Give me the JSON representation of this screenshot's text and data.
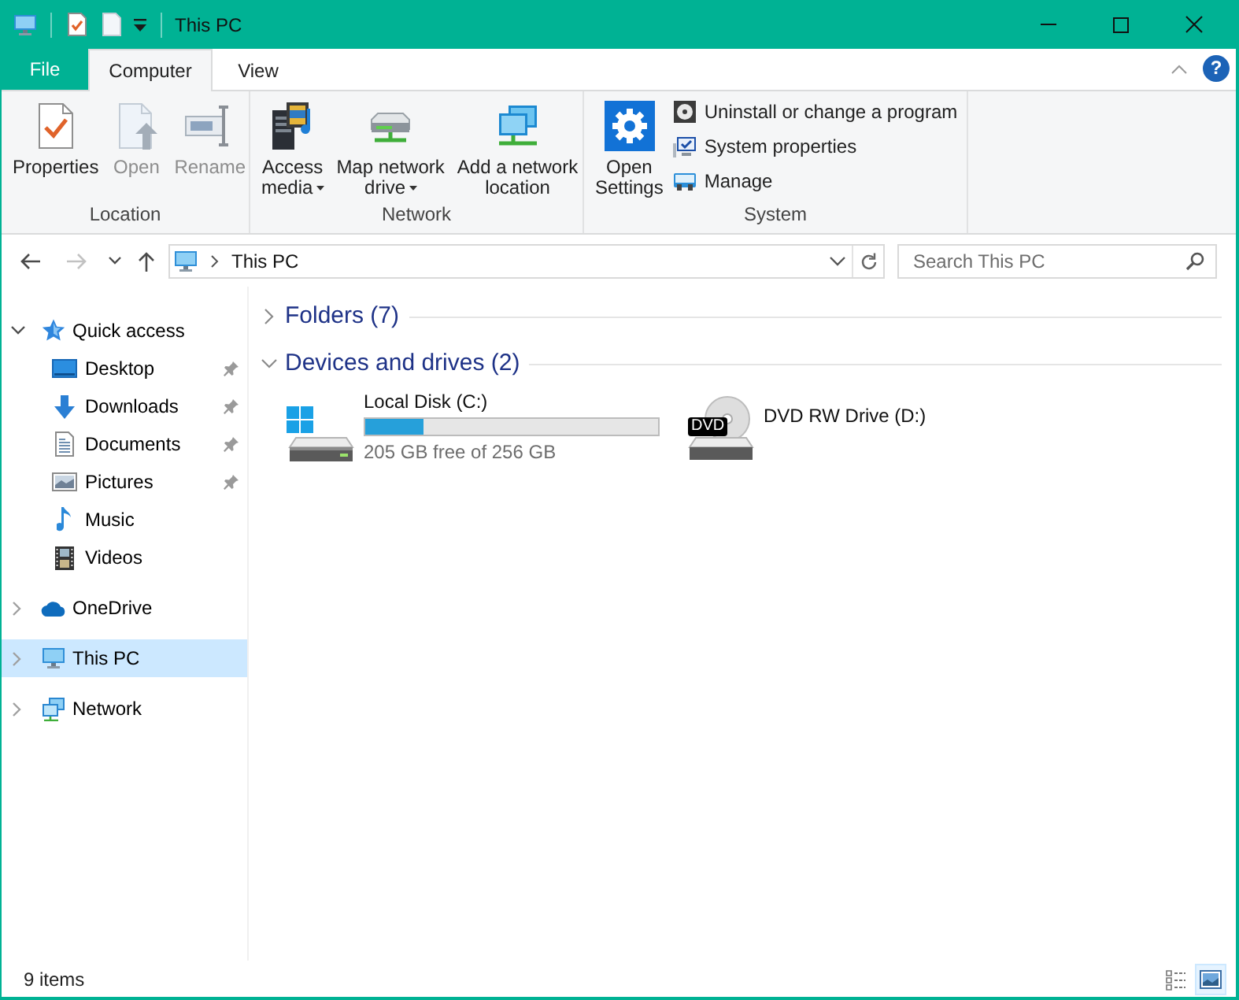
{
  "window": {
    "title": "This PC"
  },
  "ribbon": {
    "tabs": [
      {
        "label": "File",
        "kind": "file",
        "selected": false
      },
      {
        "label": "Computer",
        "kind": "tab",
        "selected": true
      },
      {
        "label": "View",
        "kind": "tab",
        "selected": false
      }
    ],
    "help": "?",
    "groups": [
      {
        "label": "Location",
        "buttons": [
          {
            "kind": "large",
            "lines": [
              "Properties"
            ],
            "dropdown": false,
            "disabled": false
          },
          {
            "kind": "large",
            "lines": [
              "Open"
            ],
            "dropdown": false,
            "disabled": true
          },
          {
            "kind": "large",
            "lines": [
              "Rename"
            ],
            "dropdown": false,
            "disabled": true
          }
        ]
      },
      {
        "label": "Network",
        "buttons": [
          {
            "kind": "large",
            "lines": [
              "Access",
              "media"
            ],
            "dropdown": true,
            "disabled": false
          },
          {
            "kind": "large",
            "lines": [
              "Map network",
              "drive"
            ],
            "dropdown": true,
            "disabled": false
          },
          {
            "kind": "large",
            "lines": [
              "Add a network",
              "location"
            ],
            "dropdown": false,
            "disabled": false
          }
        ]
      },
      {
        "label": "System",
        "buttons": [
          {
            "kind": "large",
            "lines": [
              "Open",
              "Settings"
            ],
            "dropdown": false,
            "disabled": false
          },
          {
            "kind": "small",
            "lines": [
              "Uninstall or change a program"
            ],
            "dropdown": false,
            "disabled": false
          },
          {
            "kind": "small",
            "lines": [
              "System properties"
            ],
            "dropdown": false,
            "disabled": false
          },
          {
            "kind": "small",
            "lines": [
              "Manage"
            ],
            "dropdown": false,
            "disabled": false
          }
        ]
      }
    ]
  },
  "navigation": [
    {
      "kind": "back",
      "disabled": false
    },
    {
      "kind": "forward",
      "disabled": true
    },
    {
      "kind": "recent",
      "disabled": false
    },
    {
      "kind": "up",
      "disabled": false
    }
  ],
  "address_bar": {
    "path": [
      "This PC"
    ]
  },
  "search": {
    "placeholder": "Search This PC"
  },
  "sidebar": {
    "items": [
      {
        "label": "Quick access",
        "expanded": true,
        "selected": false,
        "children": [
          {
            "label": "Desktop",
            "pinned": true,
            "selected": false
          },
          {
            "label": "Downloads",
            "pinned": true,
            "selected": false
          },
          {
            "label": "Documents",
            "pinned": true,
            "selected": false
          },
          {
            "label": "Pictures",
            "pinned": true,
            "selected": false
          },
          {
            "label": "Music",
            "pinned": false,
            "selected": false
          },
          {
            "label": "Videos",
            "pinned": false,
            "selected": false
          }
        ]
      },
      {
        "label": "OneDrive",
        "expanded": false,
        "selected": false
      },
      {
        "label": "This PC",
        "expanded": false,
        "selected": true
      },
      {
        "label": "Network",
        "expanded": false,
        "selected": false
      }
    ]
  },
  "content": {
    "groups": [
      {
        "label": "Folders (7)",
        "expanded": false
      },
      {
        "label": "Devices and drives (2)",
        "expanded": true,
        "items": [
          {
            "kind": "disk",
            "name": "Local Disk (C:)",
            "level": 0.2,
            "detail": "205 GB free of 256 GB"
          },
          {
            "kind": "optical",
            "name": "DVD RW Drive (D:)",
            "badge": "DVD"
          }
        ]
      }
    ]
  },
  "status_bar": {
    "text": "9 items",
    "views": [
      {
        "kind": "details",
        "selected": false
      },
      {
        "kind": "large_icons",
        "selected": true
      }
    ]
  }
}
